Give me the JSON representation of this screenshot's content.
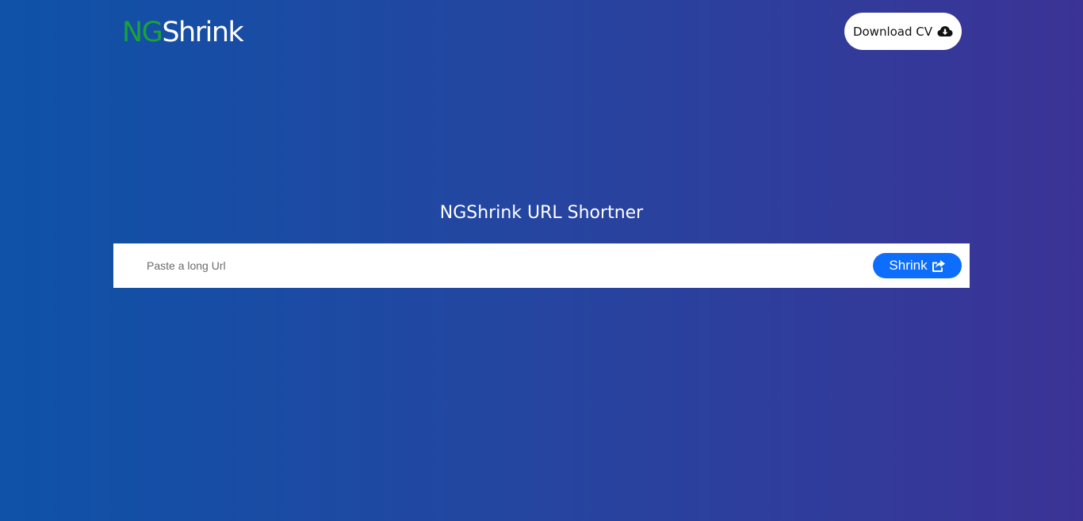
{
  "header": {
    "logo_prefix": "NG",
    "logo_suffix": "Shrink",
    "cv_button_label": "Download CV",
    "cv_button_icon": "cloud-download-icon"
  },
  "main": {
    "title": "NGShrink URL Shortner",
    "url_input": {
      "placeholder": "Paste a long Url",
      "value": ""
    },
    "shrink_button_label": "Shrink",
    "shrink_button_icon": "share-square-icon"
  },
  "colors": {
    "background_gradient_start": "#0f52a8",
    "background_gradient_end": "#3b3396",
    "logo_accent": "#1aa23a",
    "primary_button": "#0d6efd"
  }
}
